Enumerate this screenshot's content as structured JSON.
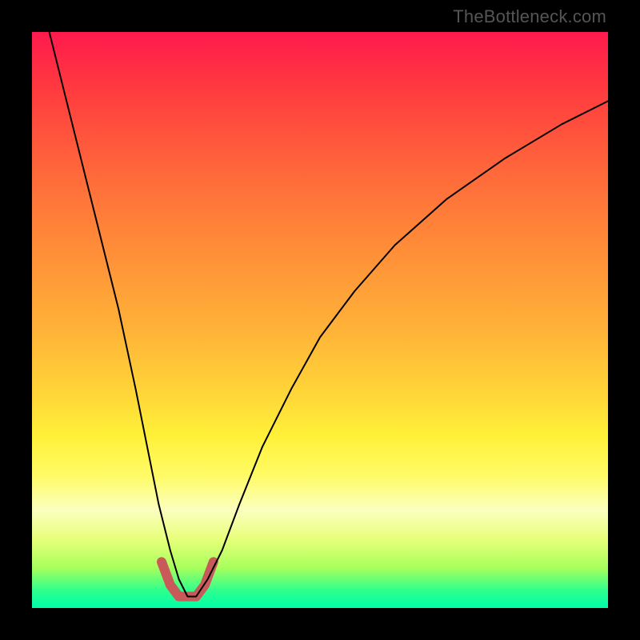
{
  "watermark": "TheBottleneck.com",
  "chart_data": {
    "type": "line",
    "title": "",
    "xlabel": "",
    "ylabel": "",
    "xlim": [
      0,
      100
    ],
    "ylim": [
      0,
      100
    ],
    "grid": false,
    "legend": false,
    "series": [
      {
        "name": "bottleneck-curve",
        "x": [
          3,
          7,
          11,
          15,
          18,
          20,
          22,
          24,
          25.5,
          27,
          28.5,
          30.5,
          33,
          36,
          40,
          45,
          50,
          56,
          63,
          72,
          82,
          92,
          100
        ],
        "y": [
          100,
          84,
          68,
          52,
          38,
          28,
          18,
          10,
          5,
          2,
          2,
          5,
          10,
          18,
          28,
          38,
          47,
          55,
          63,
          71,
          78,
          84,
          88
        ],
        "color": "#000000",
        "width": 2
      },
      {
        "name": "trough-highlight",
        "x": [
          22.5,
          24,
          25.5,
          27,
          28.5,
          30,
          31.5
        ],
        "y": [
          8,
          4,
          2,
          2,
          2,
          4,
          8
        ],
        "color": "#c85a5a",
        "width": 12
      }
    ]
  }
}
